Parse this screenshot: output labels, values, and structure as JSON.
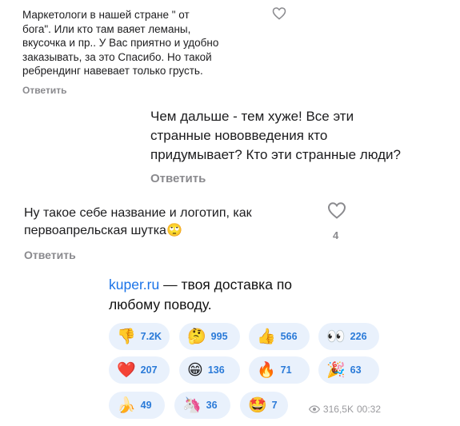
{
  "comments": [
    {
      "lines": [
        "Маркетологи в нашей стране \" от",
        "бога\". Или кто там ваяет леманы,",
        "вкусочка и пр.. У Вас приятно и удобно",
        "заказывать, за это Спасибо. Но такой",
        "ребрендинг навевает только грусть."
      ],
      "reply": "Ответить"
    },
    {
      "lines": [
        "Чем дальше - тем хуже! Все эти",
        "странные нововведения кто",
        "придумывает? Кто эти странные люди?"
      ],
      "reply": "Ответить"
    },
    {
      "lines": [
        "Ну такое себе название и логотип, как",
        "первоапрельская шутка🙄"
      ],
      "reply": "Ответить",
      "likes": "4"
    }
  ],
  "post": {
    "link": "kuper.ru",
    "text_after_link": " — твоя доставка по",
    "line2": "любому поводу.",
    "reactions": [
      {
        "emoji": "👎",
        "count": "7.2K"
      },
      {
        "emoji": "🤔",
        "count": "995"
      },
      {
        "emoji": "👍",
        "count": "566"
      },
      {
        "emoji": "👀",
        "count": "226"
      },
      {
        "emoji": "❤️",
        "count": "207"
      },
      {
        "emoji": "😁",
        "count": "136"
      },
      {
        "emoji": "🔥",
        "count": "71"
      },
      {
        "emoji": "🎉",
        "count": "63"
      },
      {
        "emoji": "🍌",
        "count": "49"
      },
      {
        "emoji": "🦄",
        "count": "36"
      },
      {
        "emoji": "🤩",
        "count": "7"
      }
    ],
    "views": "316,5K",
    "time": "00:32"
  },
  "icons": {
    "like": "heart-outline-icon",
    "views": "eye-icon"
  },
  "colors": {
    "reaction_bg": "#e9f1fc",
    "reaction_text": "#2a7ad8",
    "link": "#1a73e8"
  }
}
